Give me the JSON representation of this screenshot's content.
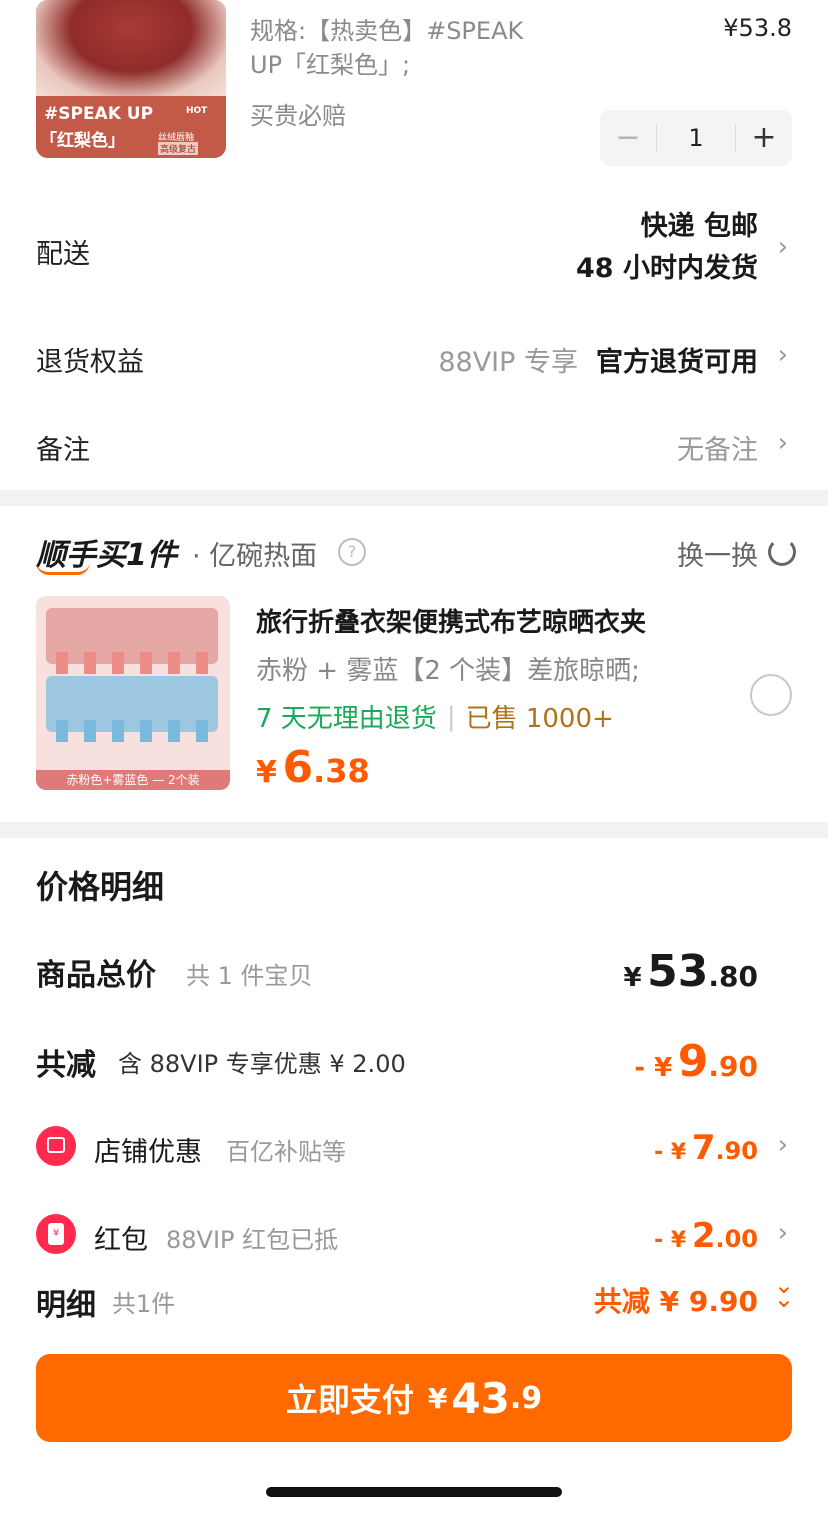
{
  "product": {
    "spec_line1": "规格:【热卖色】#SPEAK",
    "spec_line2": "UP「红梨色」;",
    "price": "¥53.8",
    "guarantee": "买贵必赔",
    "quantity": "1",
    "thumb_title": "#SPEAK UP",
    "thumb_hot": "HOT",
    "thumb_color": "「红梨色」",
    "thumb_small1": "丝绒唇釉",
    "thumb_small2": "高级复古"
  },
  "delivery": {
    "label": "配送",
    "line1": "快递 包邮",
    "line2": "48 小时内发货"
  },
  "returns": {
    "label": "退货权益",
    "vip": "88VIP 专享",
    "value": "官方退货可用"
  },
  "note": {
    "label": "备注",
    "value": "无备注"
  },
  "addon": {
    "title": "顺手买1件",
    "subtitle": "· 亿碗热面",
    "swap": "换一换",
    "name": "旅行折叠衣架便携式布艺晾晒衣夹",
    "variant": "赤粉 + 雾蓝【2 个装】差旅晾晒;",
    "return_policy": "7 天无理由退货",
    "sold": "已售 1000+",
    "price_currency": "¥",
    "price_int": "6",
    "price_dec": ".38",
    "thumb_caption": "赤粉色+雾蓝色 — 2个装"
  },
  "breakdown": {
    "title": "价格明细",
    "total_label": "商品总价",
    "total_count": "共 1 件宝贝",
    "total_currency": "¥",
    "total_int": "53",
    "total_dec": ".80",
    "reduce_label": "共减",
    "reduce_note": "含 88VIP 专享优惠 ¥ 2.00",
    "reduce_prefix": "- ¥",
    "reduce_int": "9",
    "reduce_dec": ".90",
    "shop_label": "店铺优惠",
    "shop_note": "百亿补贴等",
    "shop_prefix": "- ¥",
    "shop_int": "7",
    "shop_dec": ".90",
    "redpack_label": "红包",
    "redpack_note": "88VIP 红包已抵",
    "redpack_prefix": "- ¥",
    "redpack_int": "2",
    "redpack_dec": ".00"
  },
  "footer": {
    "detail_label": "明细",
    "detail_count": "共1件",
    "total_reduce": "共减 ¥ 9.90",
    "pay_label": "立即支付",
    "pay_currency": "¥",
    "pay_int": "43",
    "pay_dec": ".9"
  },
  "colors": {
    "accent": "#ff6a00",
    "discount": "#ff5a00",
    "green": "#1aaa55"
  }
}
